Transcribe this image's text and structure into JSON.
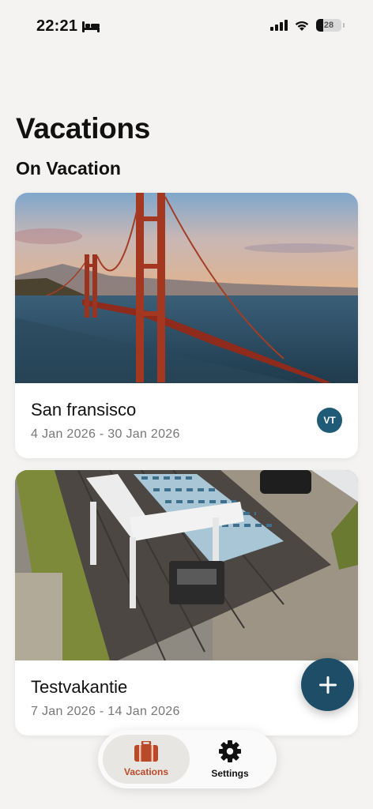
{
  "status_bar": {
    "time": "22:21",
    "battery": "28"
  },
  "page": {
    "title": "Vacations",
    "section_title": "On Vacation"
  },
  "vacations": [
    {
      "title": "San fransisco",
      "dates": "4 Jan 2026 - 30 Jan 2026",
      "avatar_initials": "VT"
    },
    {
      "title": "Testvakantie",
      "dates": "7 Jan 2026 - 14 Jan 2026"
    }
  ],
  "bottom_nav": {
    "items": [
      {
        "label": "Vacations",
        "icon": "suitcase-icon",
        "active": true
      },
      {
        "label": "Settings",
        "icon": "gear-icon",
        "active": false
      }
    ]
  },
  "colors": {
    "accent": "#b84a2a",
    "primary": "#1e4e67",
    "avatar": "#1f5a77",
    "background": "#f4f3f1"
  }
}
